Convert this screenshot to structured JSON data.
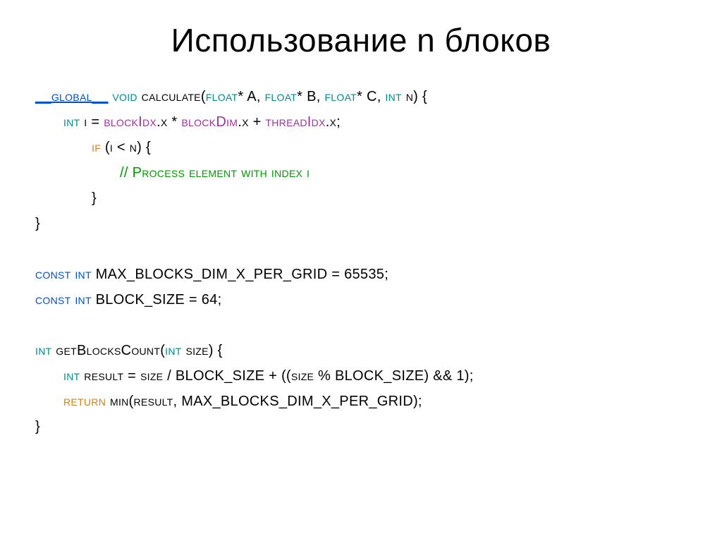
{
  "title": "Использование n блоков",
  "code": {
    "l1a": "__global__",
    "l1b": " void",
    "l1c": " calculate(",
    "l1d": "float",
    "l1e": "* A, ",
    "l1f": "float",
    "l1g": "* B, ",
    "l1h": "float",
    "l1i": "* C, ",
    "l1j": "int",
    "l1k": " n) {",
    "l2a": "int",
    "l2b": " i = ",
    "l2c": "blockIdx",
    "l2d": ".x * ",
    "l2e": "blockDim",
    "l2f": ".x + ",
    "l2g": "threadIdx",
    "l2h": ".x;",
    "l3a": "if",
    "l3b": " (i < n) {",
    "l4": "// Process element with index i",
    "l5": "}",
    "l6": "}",
    "l7a": "const int",
    "l7b": " MAX_BLOCKS_DIM_X_PER_GRID = 65535;",
    "l8a": "const int",
    "l8b": " BLOCK_SIZE = 64;",
    "l9a": "int",
    "l9b": " getBlocksCount(",
    "l9c": "int",
    "l9d": " size) {",
    "l10a": "int",
    "l10b": " result = size / BLOCK_SIZE + ((size % BLOCK_SIZE) && 1);",
    "l11a": "return",
    "l11b": " min(result, MAX_BLOCKS_DIM_X_PER_GRID);",
    "l12": "}"
  }
}
